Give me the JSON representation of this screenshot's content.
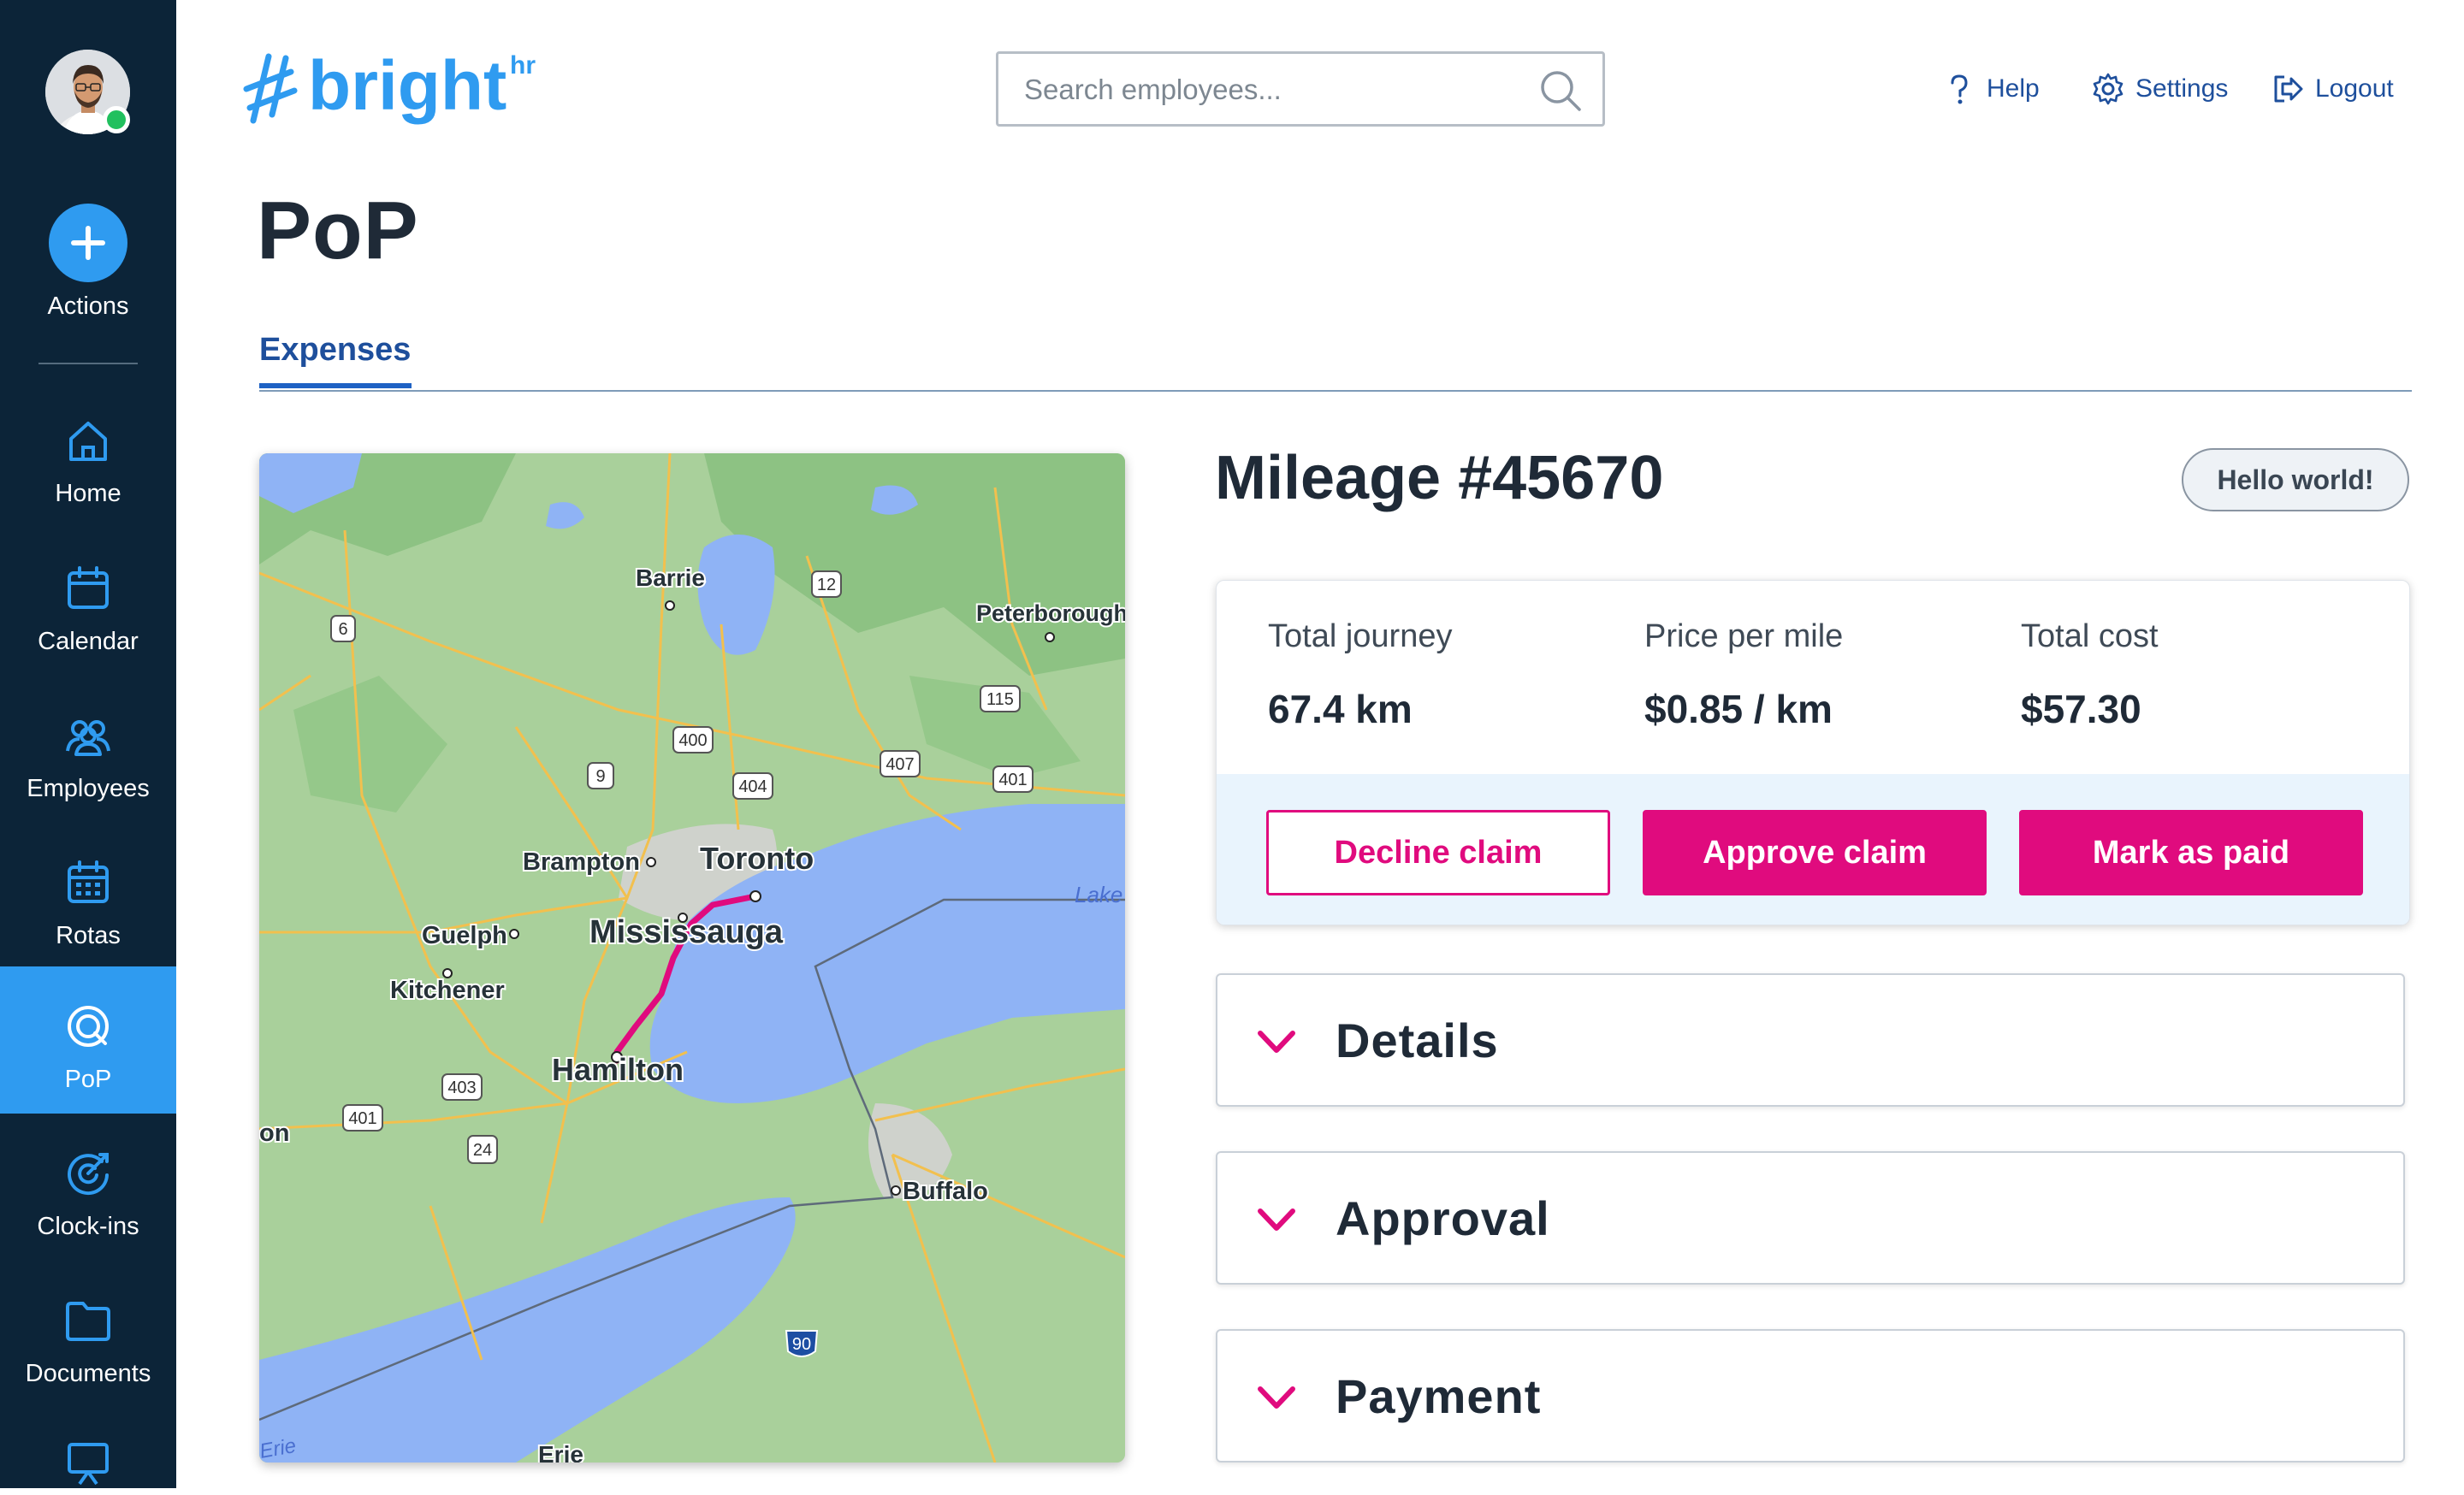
{
  "sidebar": {
    "actions_label": "Actions",
    "items": [
      {
        "label": "Home",
        "icon": "home-icon"
      },
      {
        "label": "Calendar",
        "icon": "calendar-icon"
      },
      {
        "label": "Employees",
        "icon": "employees-icon"
      },
      {
        "label": "Rotas",
        "icon": "rotas-icon"
      },
      {
        "label": "PoP",
        "icon": "pop-icon",
        "active": true
      },
      {
        "label": "Clock-ins",
        "icon": "clock-ins-icon"
      },
      {
        "label": "Documents",
        "icon": "documents-icon"
      }
    ]
  },
  "header": {
    "logo_text": "bright",
    "logo_sup": "hr",
    "search_placeholder": "Search employees...",
    "help_label": "Help",
    "settings_label": "Settings",
    "logout_label": "Logout"
  },
  "page": {
    "title": "PoP",
    "tabs": [
      {
        "label": "Expenses",
        "active": true
      }
    ]
  },
  "map": {
    "labels": {
      "barrie": "Barrie",
      "peterborough": "Peterborough",
      "brampton": "Brampton",
      "toronto": "Toronto",
      "mississauga": "Mississauga",
      "guelph": "Guelph",
      "kitchener": "Kitchener",
      "hamilton": "Hamilton",
      "buffalo": "Buffalo",
      "lake": "Lake",
      "on": "on",
      "erie": "Erie",
      "erie_small": "Erie"
    },
    "shields": [
      "6",
      "12",
      "115",
      "400",
      "9",
      "404",
      "407",
      "401",
      "403",
      "401",
      "24",
      "90"
    ],
    "route_color": "#e00b7e"
  },
  "claim": {
    "title": "Mileage #45670",
    "badge": "Hello world!",
    "stats": [
      {
        "label": "Total journey",
        "value": "67.4 km"
      },
      {
        "label": "Price per mile",
        "value": "$0.85 / km"
      },
      {
        "label": "Total cost",
        "value": "$57.30"
      }
    ],
    "buttons": {
      "decline": "Decline claim",
      "approve": "Approve claim",
      "paid": "Mark as paid"
    },
    "sections": [
      "Details",
      "Approval",
      "Payment"
    ]
  },
  "colors": {
    "sidebar_bg": "#0c2438",
    "accent_blue": "#2f9bf0",
    "brand_pink": "#e00b7e",
    "link_blue": "#1e4f9c"
  }
}
